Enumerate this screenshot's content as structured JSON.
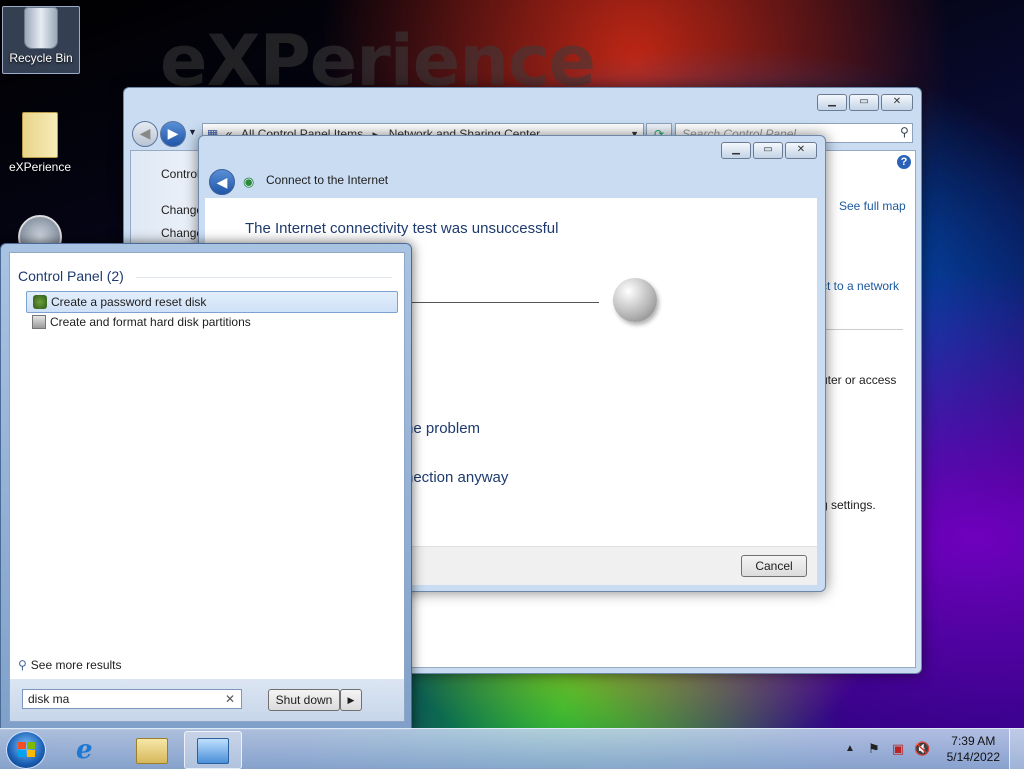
{
  "wallpaper": {
    "text": "eXPerience"
  },
  "desktop": {
    "icons": [
      {
        "label": "Recycle Bin"
      },
      {
        "label": "eXPerience"
      }
    ]
  },
  "control_panel_window": {
    "breadcrumb": [
      "All Control Panel Items",
      "Network and Sharing Center"
    ],
    "search_placeholder": "Search Control Panel",
    "left_links": [
      "Control",
      "Change",
      "Change"
    ],
    "right_links": {
      "see_full_map": "See full map",
      "connect_network": "ct to a network",
      "router_text": "uter or access",
      "settings_text": "g settings."
    },
    "help_icon": "help-icon"
  },
  "connect_dialog": {
    "title": "Connect to the Internet",
    "heading": "The Internet connectivity test was unsuccessful",
    "option1": "he problem",
    "option2": "nection anyway",
    "cancel_label": "Cancel"
  },
  "start_menu": {
    "group_header": "Control Panel (2)",
    "results": [
      {
        "label": "Create a password reset disk",
        "icon": "users-icon",
        "selected": true
      },
      {
        "label": "Create and format hard disk partitions",
        "icon": "disk-management-icon",
        "selected": false
      }
    ],
    "see_more": "See more results",
    "search_value": "disk ma",
    "shutdown_label": "Shut down"
  },
  "taskbar": {
    "pinned": [
      "start-orb",
      "internet-explorer-icon",
      "windows-explorer-icon",
      "control-panel-icon"
    ],
    "time": "7:39 AM",
    "date": "5/14/2022"
  },
  "colors": {
    "link": "#1e5aa0",
    "selection": "#cfe1f7"
  }
}
